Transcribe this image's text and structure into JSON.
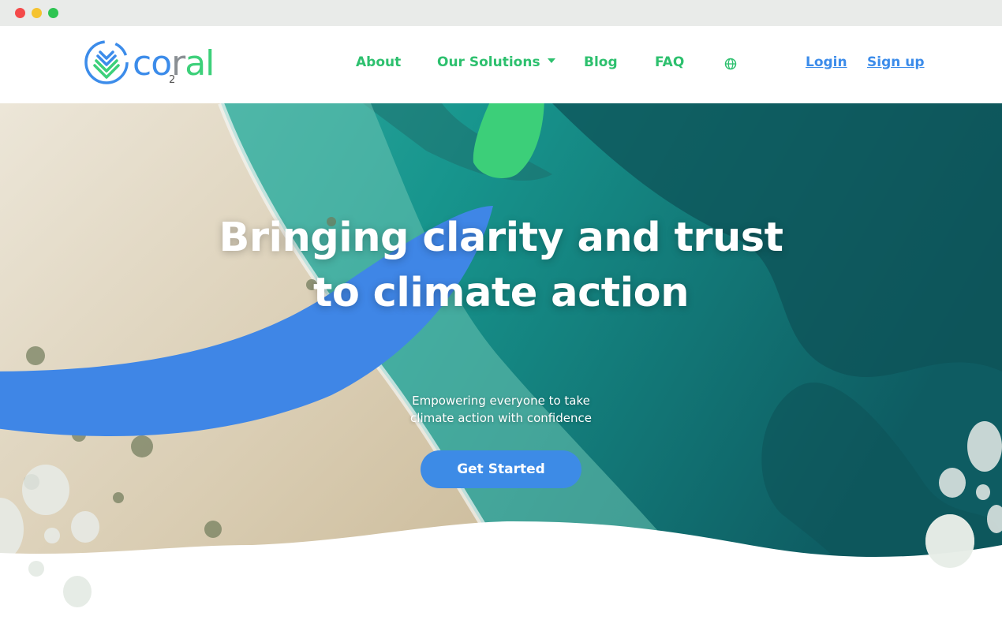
{
  "browser": {
    "buttons": [
      "close",
      "minimize",
      "maximize"
    ]
  },
  "brand": {
    "name": "coral",
    "name_part1": "co",
    "name_part2": "r",
    "name_part3": "al",
    "subscript": "2",
    "colors": {
      "blue": "#3c8cea",
      "green": "#3dd07a",
      "grey": "#8a8f94"
    }
  },
  "nav": {
    "about": "About",
    "solutions": "Our Solutions",
    "blog": "Blog",
    "faq": "FAQ",
    "language_icon": "globe-icon",
    "login": "Login",
    "signup": "Sign up",
    "link_color": "#2dc06e",
    "auth_color": "#3c8cea"
  },
  "hero": {
    "title_line1": "Bringing clarity and trust",
    "title_line2": "to climate action",
    "subtitle_line1": "Empowering everyone to take",
    "subtitle_line2": "climate action with confidence",
    "cta": "Get Started",
    "cta_color": "#3d8be6",
    "background": "aerial view of beach and turquoise sea"
  }
}
